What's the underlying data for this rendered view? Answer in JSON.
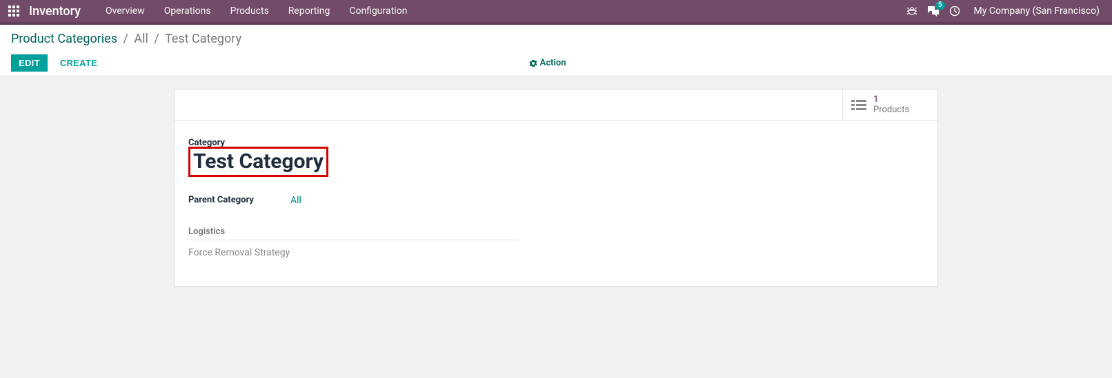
{
  "navbar": {
    "brand": "Inventory",
    "menu": [
      "Overview",
      "Operations",
      "Products",
      "Reporting",
      "Configuration"
    ],
    "messages_badge": "5",
    "company": "My Company (San Francisco)"
  },
  "breadcrumb": {
    "root": "Product Categories",
    "parts": [
      "All",
      "Test Category"
    ]
  },
  "controls": {
    "edit": "EDIT",
    "create": "CREATE",
    "action": "Action"
  },
  "stat": {
    "count": "1",
    "label": "Products"
  },
  "form": {
    "category_label": "Category",
    "category_value": "Test Category",
    "parent_label": "Parent Category",
    "parent_value": "All",
    "logistics_heading": "Logistics",
    "removal_label": "Force Removal Strategy"
  }
}
